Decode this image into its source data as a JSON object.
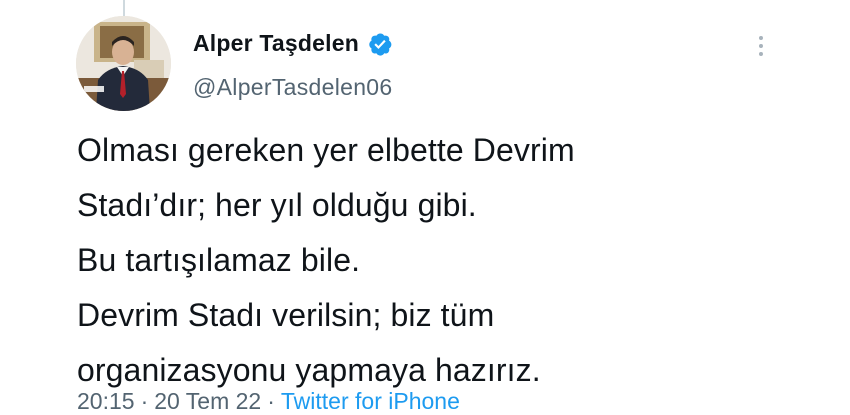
{
  "author": {
    "display_name": "Alper Taşdelen",
    "handle": "@AlperTasdelen06",
    "verified": true,
    "avatar_icon": "profile-photo-icon",
    "verified_icon": "verified-badge-icon"
  },
  "tweet": {
    "lines": [
      "Olması gereken yer elbette Devrim",
      "Stadı’dır; her yıl olduğu gibi.",
      "Bu tartışılamaz bile.",
      "Devrim Stadı verilsin; biz tüm",
      "organizasyonu yapmaya hazırız."
    ]
  },
  "meta": {
    "time": "20:15",
    "separator": "·",
    "date": "20 Tem 22",
    "source": "Twitter for iPhone"
  },
  "colors": {
    "text": "#0f1419",
    "secondary": "#536471",
    "accent": "#1d9bf0",
    "verified": "#1d9bf0"
  },
  "menu": {
    "more_icon": "more-vertical-icon"
  }
}
